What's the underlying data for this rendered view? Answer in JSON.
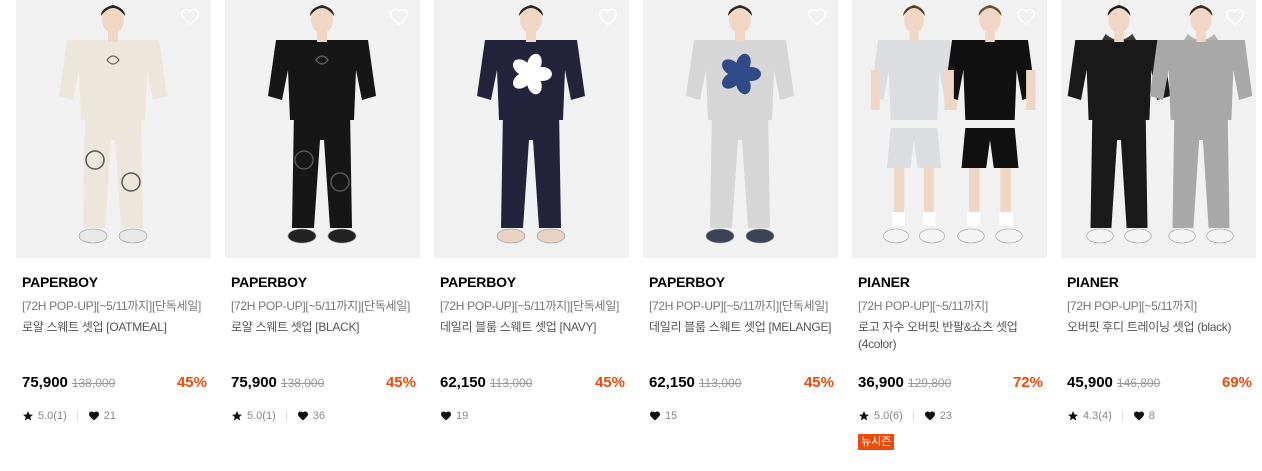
{
  "products": [
    {
      "brand": "PAPERBOY",
      "tagline": "[72H POP-UP][~5/11까지][단독세일]",
      "name": "로얄 스웨트 셋업 [OATMEAL]",
      "price": "75,900",
      "original": "138,000",
      "rate": "45%",
      "rating": "5.0(1)",
      "likes": "21",
      "badge": "",
      "top": "#ece7da",
      "bottom": "#ece7da",
      "shoes": "#e8e8e8",
      "graphic": "emblem",
      "model": "female"
    },
    {
      "brand": "PAPERBOY",
      "tagline": "[72H POP-UP][~5/11까지][단독세일]",
      "name": "로얄 스웨트 셋업 [BLACK]",
      "price": "75,900",
      "original": "138,000",
      "rate": "45%",
      "rating": "5.0(1)",
      "likes": "36",
      "badge": "",
      "top": "#161616",
      "bottom": "#161616",
      "shoes": "#222222",
      "graphic": "emblem",
      "model": "female"
    },
    {
      "brand": "PAPERBOY",
      "tagline": "[72H POP-UP][~5/11까지][단독세일]",
      "name": "데일리 블룸 스웨트 셋업 [NAVY]",
      "price": "62,150",
      "original": "113,000",
      "rate": "45%",
      "rating": "",
      "likes": "19",
      "badge": "",
      "top": "#23243c",
      "bottom": "#23243c",
      "shoes": "#e8d2c3",
      "graphic": "flower-white",
      "model": "female"
    },
    {
      "brand": "PAPERBOY",
      "tagline": "[72H POP-UP][~5/11까지][단독세일]",
      "name": "데일리 블룸 스웨트 셋업 [MELANGE]",
      "price": "62,150",
      "original": "113,000",
      "rate": "45%",
      "rating": "",
      "likes": "15",
      "badge": "",
      "top": "#d6d6d6",
      "bottom": "#d6d6d6",
      "shoes": "#3b4258",
      "graphic": "flower-navy",
      "model": "female"
    },
    {
      "brand": "PIANER",
      "tagline": "[72H POP-UP][~5/11까지]",
      "name": "로고 자수 오버핏 반팔&쇼츠 셋업 (4color)",
      "price": "36,900",
      "original": "129,800",
      "rate": "72%",
      "rating": "5.0(6)",
      "likes": "23",
      "badge": "뉴시즌",
      "top": "#dcdde0",
      "bottom": "#dcdde0",
      "shoes": "#f4f4f4",
      "graphic": "",
      "model": "pair-tee"
    },
    {
      "brand": "PIANER",
      "tagline": "[72H POP-UP][~5/11까지]",
      "name": "오버핏 후디 트레이닝 셋업 (black)",
      "price": "45,900",
      "original": "146,800",
      "rate": "69%",
      "rating": "4.3(4)",
      "likes": "8",
      "badge": "",
      "top": "#1a1a1a",
      "bottom": "#1a1a1a",
      "shoes": "#f4f4f4",
      "graphic": "",
      "model": "pair-hoodie"
    }
  ],
  "colors": {
    "accent": "#f04a0b",
    "icon": "#111111"
  }
}
